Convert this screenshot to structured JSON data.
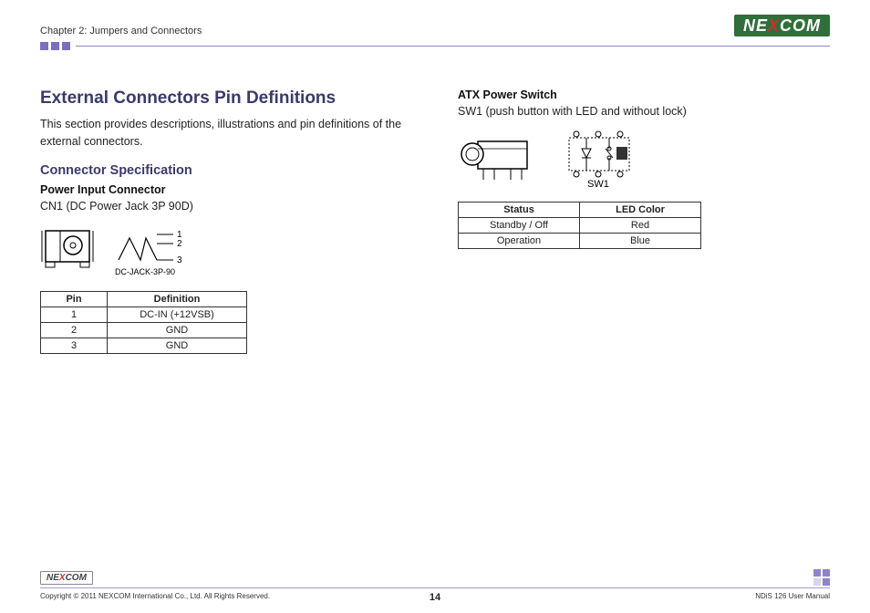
{
  "header": {
    "chapter": "Chapter 2: Jumpers and Connectors",
    "logo_left": "NE",
    "logo_mid": "X",
    "logo_right": "COM"
  },
  "left": {
    "title": "External Connectors Pin Definitions",
    "intro": "This section provides descriptions, illustrations and pin definitions of the external connectors.",
    "spec_heading": "Connector Specification",
    "pic_heading": "Power Input Connector",
    "pic_desc": "CN1 (DC Power Jack 3P 90D)",
    "figure_label": "DC-JACK-3P-90",
    "pin_labels": {
      "p1": "1",
      "p2": "2",
      "p3": "3"
    },
    "table": {
      "headers": [
        "Pin",
        "Definition"
      ],
      "rows": [
        [
          "1",
          "DC-IN (+12VSB)"
        ],
        [
          "2",
          "GND"
        ],
        [
          "3",
          "GND"
        ]
      ]
    }
  },
  "right": {
    "atx_heading": "ATX Power Switch",
    "atx_desc": "SW1 (push button with LED and without lock)",
    "schematic_label": "SW1",
    "table": {
      "headers": [
        "Status",
        "LED Color"
      ],
      "rows": [
        [
          "Standby / Off",
          "Red"
        ],
        [
          "Operation",
          "Blue"
        ]
      ]
    }
  },
  "footer": {
    "logo_left": "NE",
    "logo_mid": "X",
    "logo_right": "COM",
    "copyright": "Copyright © 2011 NEXCOM International Co., Ltd. All Rights Reserved.",
    "page_number": "14",
    "manual": "NDiS 126 User Manual"
  }
}
